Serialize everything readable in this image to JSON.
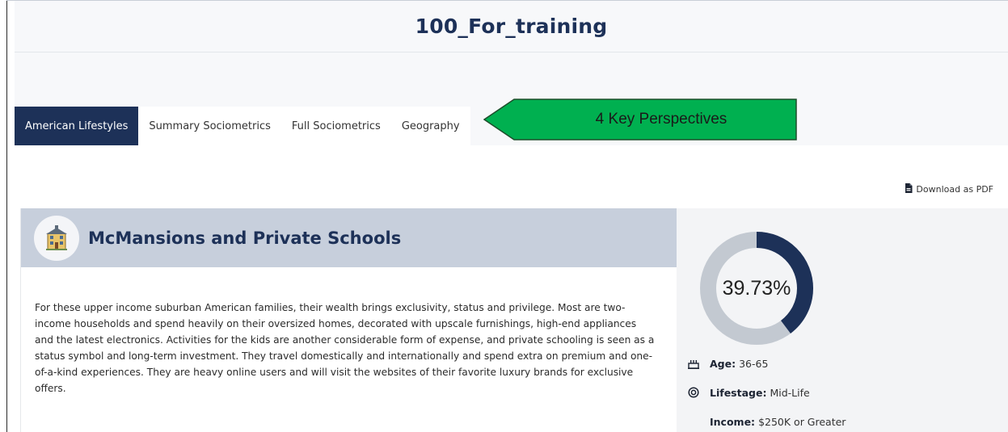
{
  "header": {
    "title": "100_For_training"
  },
  "tabs": [
    {
      "label": "American Lifestyles",
      "active": true
    },
    {
      "label": "Summary Sociometrics",
      "active": false
    },
    {
      "label": "Full Sociometrics",
      "active": false
    },
    {
      "label": "Geography",
      "active": false
    }
  ],
  "callout": {
    "text": "4 Key Perspectives",
    "color": "#00b050"
  },
  "actions": {
    "download_label": "Download as PDF"
  },
  "segment": {
    "name": "McMansions and Private Schools",
    "description": "For these upper income suburban American families, their wealth brings exclusivity, status and privilege. Most are two-income households and spend heavily on their oversized homes, decorated with upscale furnishings, high-end appliances and the latest electronics. Activities for the kids are another considerable form of expense, and private schooling is seen as a status symbol and long-term investment. They travel domestically and internationally and spend extra on premium and one-of-a-kind experiences. They are heavy online users and will visit the websites of their favorite luxury brands for exclusive offers.",
    "percent_label": "39.73%",
    "percent_value": 39.73,
    "stats": [
      {
        "icon": "age-icon",
        "label": "Age:",
        "value": "36-65"
      },
      {
        "icon": "lifestage-icon",
        "label": "Lifestage:",
        "value": "Mid-Life"
      },
      {
        "icon": "",
        "label": "Income:",
        "value": "$250K or Greater"
      }
    ]
  },
  "colors": {
    "brand_navy": "#1d3158",
    "header_band": "#c7cfdc",
    "donut_track": "#c3c9d1"
  }
}
